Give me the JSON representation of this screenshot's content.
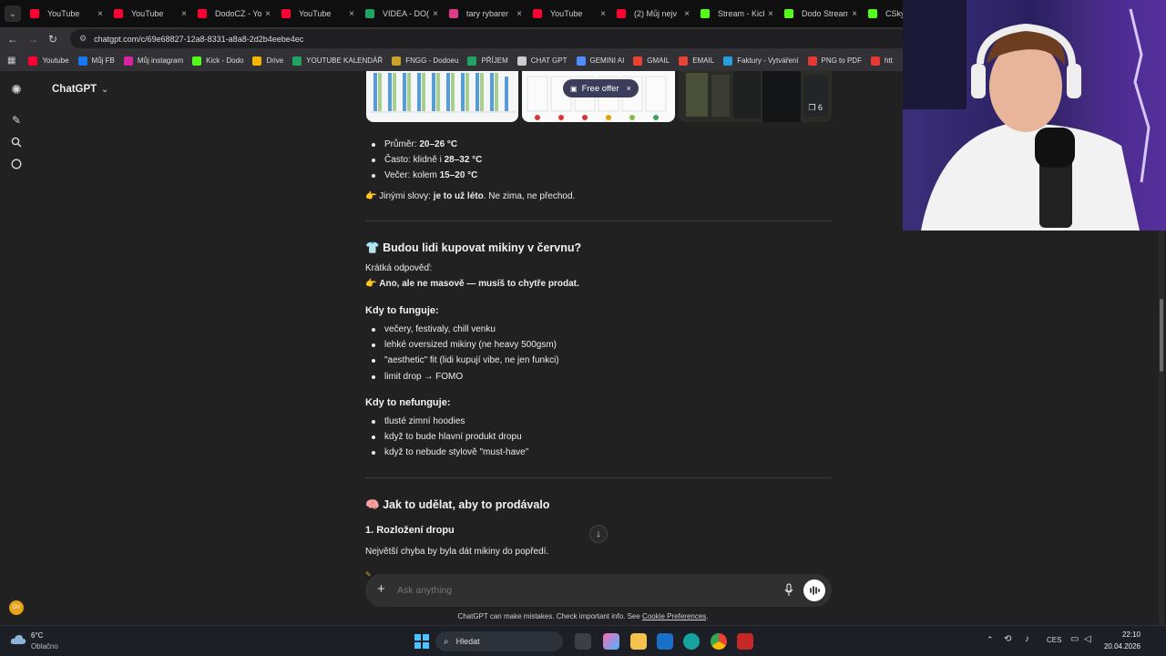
{
  "browser": {
    "tabs": [
      {
        "title": "YouTube",
        "color": "#ff0033"
      },
      {
        "title": "YouTube",
        "color": "#ff0033"
      },
      {
        "title": "DodoCZ - Yo",
        "color": "#ff0033"
      },
      {
        "title": "YouTube",
        "color": "#ff0033"
      },
      {
        "title": "VIDEA - DO(",
        "color": "#1fa463"
      },
      {
        "title": "tary rybarer",
        "color": "#e03a8c"
      },
      {
        "title": "YouTube",
        "color": "#ff0033"
      },
      {
        "title": "(2) Můj nejv",
        "color": "#ff0033"
      },
      {
        "title": "Stream - Kick",
        "color": "#53fc18"
      },
      {
        "title": "Dodo Stream",
        "color": "#53fc18"
      },
      {
        "title": "CSkyf",
        "color": "#53fc18"
      }
    ],
    "url": "chatgpt.com/c/69e68827-12a8-8331-a8a8-2d2b4eebe4ec",
    "bookmarks": [
      {
        "label": "Youtube",
        "color": "#ff0033"
      },
      {
        "label": "Můj FB",
        "color": "#1877f2"
      },
      {
        "label": "Můj instagram",
        "color": "#d6249f"
      },
      {
        "label": "Kick - Dodo",
        "color": "#53fc18"
      },
      {
        "label": "Drive",
        "color": "#f4b400"
      },
      {
        "label": "YOUTUBE KALENDÁŘ",
        "color": "#1fa463"
      },
      {
        "label": "FNGG - Dodoeu",
        "color": "#c9a227"
      },
      {
        "label": "PŘÍJEM",
        "color": "#1fa463"
      },
      {
        "label": "CHAT GPT",
        "color": "#cccccc"
      },
      {
        "label": "GEMINI AI",
        "color": "#4f8cff"
      },
      {
        "label": "GMAIL",
        "color": "#ea4335"
      },
      {
        "label": "EMAIL",
        "color": "#ea4335"
      },
      {
        "label": "Faktury - Vytváření",
        "color": "#2a9fd8"
      },
      {
        "label": "PNG to PDF",
        "color": "#e53935"
      },
      {
        "label": "htt",
        "color": "#e53935"
      }
    ]
  },
  "app": {
    "model_label": "ChatGPT",
    "free_offer": "Free offer",
    "image_count": "6"
  },
  "message": {
    "temps": [
      {
        "pre": "Průměr: ",
        "bold": "20–26 °C"
      },
      {
        "pre": "Často: klidně i ",
        "bold": "28–32 °C"
      },
      {
        "pre": "Večer: kolem ",
        "bold": "15–20 °C"
      }
    ],
    "summary": {
      "emoji": "👉",
      "pre": "Jinými slovy: ",
      "bold": "je to už léto",
      "post": ". Ne zima, ne přechod."
    },
    "section1": {
      "emoji": "👕",
      "title": "Budou lidi kupovat mikiny v červnu?"
    },
    "short_answer_label": "Krátká odpověď:",
    "short_answer": {
      "emoji": "👉",
      "bold": "Ano, ale ne masově — musíš to chytře prodat."
    },
    "works_title": "Kdy to funguje:",
    "works": [
      "večery, festivaly, chill venku",
      "lehké oversized mikiny (ne heavy 500gsm)",
      "\"aesthetic\" fit (lidi kupují vibe, ne jen funkci)",
      "limit drop → FOMO"
    ],
    "fails_title": "Kdy to nefunguje:",
    "fails": [
      "tlusté zimní hoodies",
      "když to bude hlavní produkt dropu",
      "když to nebude stylově \"must-have\""
    ],
    "section2": {
      "emoji": "🧠",
      "title": "Jak to udělat, aby to prodávalo"
    },
    "step1_title": "1. Rozložení dropu",
    "step1_text": "Největší chyba by byla dát mikiny do popředí."
  },
  "composer": {
    "placeholder": "Ask anything"
  },
  "footer": {
    "text": "ChatGPT can make mistakes. Check important info. See ",
    "link": "Cookie Preferences",
    "end": "."
  },
  "taskbar": {
    "weather_temp": "6°C",
    "weather_desc": "Oblačno",
    "search_label": "Hledat",
    "lang": "CES",
    "time": "22:10",
    "date": "20.04.2026"
  }
}
